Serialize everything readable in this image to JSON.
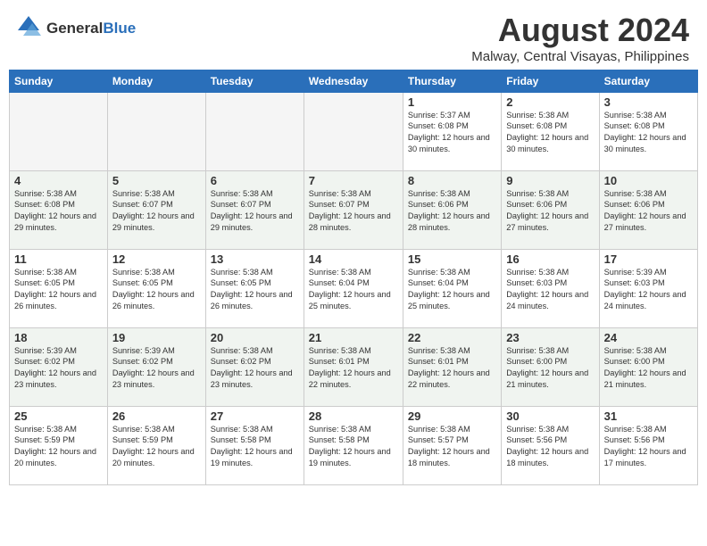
{
  "header": {
    "logo_general": "General",
    "logo_blue": "Blue",
    "month_year": "August 2024",
    "location": "Malway, Central Visayas, Philippines"
  },
  "days_of_week": [
    "Sunday",
    "Monday",
    "Tuesday",
    "Wednesday",
    "Thursday",
    "Friday",
    "Saturday"
  ],
  "weeks": [
    [
      {
        "num": "",
        "empty": true
      },
      {
        "num": "",
        "empty": true
      },
      {
        "num": "",
        "empty": true
      },
      {
        "num": "",
        "empty": true
      },
      {
        "num": "1",
        "rise": "5:37 AM",
        "set": "6:08 PM",
        "daylight": "12 hours and 30 minutes."
      },
      {
        "num": "2",
        "rise": "5:38 AM",
        "set": "6:08 PM",
        "daylight": "12 hours and 30 minutes."
      },
      {
        "num": "3",
        "rise": "5:38 AM",
        "set": "6:08 PM",
        "daylight": "12 hours and 30 minutes."
      }
    ],
    [
      {
        "num": "4",
        "rise": "5:38 AM",
        "set": "6:08 PM",
        "daylight": "12 hours and 29 minutes."
      },
      {
        "num": "5",
        "rise": "5:38 AM",
        "set": "6:07 PM",
        "daylight": "12 hours and 29 minutes."
      },
      {
        "num": "6",
        "rise": "5:38 AM",
        "set": "6:07 PM",
        "daylight": "12 hours and 29 minutes."
      },
      {
        "num": "7",
        "rise": "5:38 AM",
        "set": "6:07 PM",
        "daylight": "12 hours and 28 minutes."
      },
      {
        "num": "8",
        "rise": "5:38 AM",
        "set": "6:06 PM",
        "daylight": "12 hours and 28 minutes."
      },
      {
        "num": "9",
        "rise": "5:38 AM",
        "set": "6:06 PM",
        "daylight": "12 hours and 27 minutes."
      },
      {
        "num": "10",
        "rise": "5:38 AM",
        "set": "6:06 PM",
        "daylight": "12 hours and 27 minutes."
      }
    ],
    [
      {
        "num": "11",
        "rise": "5:38 AM",
        "set": "6:05 PM",
        "daylight": "12 hours and 26 minutes."
      },
      {
        "num": "12",
        "rise": "5:38 AM",
        "set": "6:05 PM",
        "daylight": "12 hours and 26 minutes."
      },
      {
        "num": "13",
        "rise": "5:38 AM",
        "set": "6:05 PM",
        "daylight": "12 hours and 26 minutes."
      },
      {
        "num": "14",
        "rise": "5:38 AM",
        "set": "6:04 PM",
        "daylight": "12 hours and 25 minutes."
      },
      {
        "num": "15",
        "rise": "5:38 AM",
        "set": "6:04 PM",
        "daylight": "12 hours and 25 minutes."
      },
      {
        "num": "16",
        "rise": "5:38 AM",
        "set": "6:03 PM",
        "daylight": "12 hours and 24 minutes."
      },
      {
        "num": "17",
        "rise": "5:39 AM",
        "set": "6:03 PM",
        "daylight": "12 hours and 24 minutes."
      }
    ],
    [
      {
        "num": "18",
        "rise": "5:39 AM",
        "set": "6:02 PM",
        "daylight": "12 hours and 23 minutes."
      },
      {
        "num": "19",
        "rise": "5:39 AM",
        "set": "6:02 PM",
        "daylight": "12 hours and 23 minutes."
      },
      {
        "num": "20",
        "rise": "5:38 AM",
        "set": "6:02 PM",
        "daylight": "12 hours and 23 minutes."
      },
      {
        "num": "21",
        "rise": "5:38 AM",
        "set": "6:01 PM",
        "daylight": "12 hours and 22 minutes."
      },
      {
        "num": "22",
        "rise": "5:38 AM",
        "set": "6:01 PM",
        "daylight": "12 hours and 22 minutes."
      },
      {
        "num": "23",
        "rise": "5:38 AM",
        "set": "6:00 PM",
        "daylight": "12 hours and 21 minutes."
      },
      {
        "num": "24",
        "rise": "5:38 AM",
        "set": "6:00 PM",
        "daylight": "12 hours and 21 minutes."
      }
    ],
    [
      {
        "num": "25",
        "rise": "5:38 AM",
        "set": "5:59 PM",
        "daylight": "12 hours and 20 minutes."
      },
      {
        "num": "26",
        "rise": "5:38 AM",
        "set": "5:59 PM",
        "daylight": "12 hours and 20 minutes."
      },
      {
        "num": "27",
        "rise": "5:38 AM",
        "set": "5:58 PM",
        "daylight": "12 hours and 19 minutes."
      },
      {
        "num": "28",
        "rise": "5:38 AM",
        "set": "5:58 PM",
        "daylight": "12 hours and 19 minutes."
      },
      {
        "num": "29",
        "rise": "5:38 AM",
        "set": "5:57 PM",
        "daylight": "12 hours and 18 minutes."
      },
      {
        "num": "30",
        "rise": "5:38 AM",
        "set": "5:56 PM",
        "daylight": "12 hours and 18 minutes."
      },
      {
        "num": "31",
        "rise": "5:38 AM",
        "set": "5:56 PM",
        "daylight": "12 hours and 17 minutes."
      }
    ]
  ]
}
